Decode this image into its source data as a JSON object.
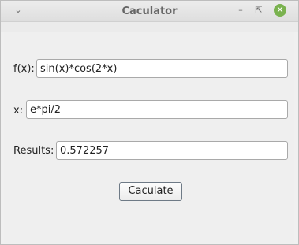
{
  "window": {
    "title": "Caculator",
    "menu_icon": "chevron-down-icon",
    "minimize_icon": "minimize-icon",
    "maximize_icon": "maximize-icon",
    "close_icon": "close-icon"
  },
  "form": {
    "fx_label": "f(x):",
    "fx_value": "sin(x)*cos(2*x)",
    "x_label": "x:",
    "x_value": "e*pi/2",
    "results_label": "Results:",
    "results_value": "0.572257",
    "calculate_label": "Caculate"
  },
  "colors": {
    "close_button": "#7ab24f",
    "window_bg": "#f0f0f0"
  }
}
